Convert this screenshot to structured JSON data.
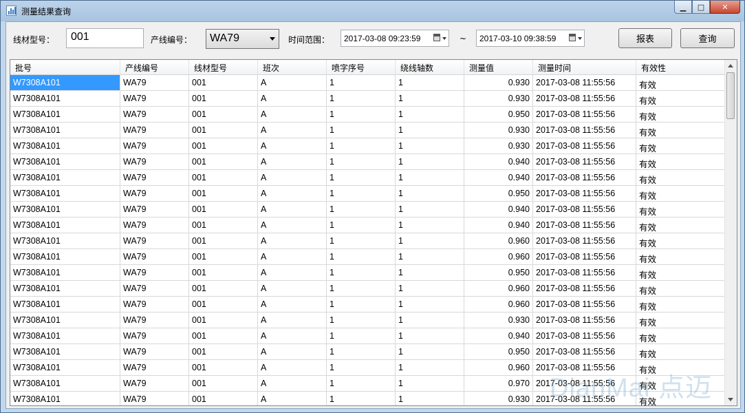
{
  "window": {
    "title": "测量结果查询",
    "buttons": {
      "minimize": "▁",
      "maximize": "□",
      "close": "✕"
    }
  },
  "filters": {
    "wire_type_label": "线材型号：",
    "wire_type_value": "001",
    "line_no_label": "产线编号：",
    "line_no_value": "WA79",
    "time_range_label": "时间范围：",
    "start_time": "2017-03-08 09:23:59",
    "tilde": "~",
    "end_time": "2017-03-10 09:38:59",
    "report_button": "报表",
    "query_button": "查询"
  },
  "table": {
    "columns": [
      "批号",
      "产线编号",
      "线材型号",
      "班次",
      "喷字序号",
      "绕线轴数",
      "测量值",
      "测量时间",
      "有效性"
    ],
    "rows": [
      [
        "W7308A101",
        "WA79",
        "001",
        "A",
        "1",
        "1",
        "0.930",
        "2017-03-08 11:55:56",
        "有效"
      ],
      [
        "W7308A101",
        "WA79",
        "001",
        "A",
        "1",
        "1",
        "0.930",
        "2017-03-08 11:55:56",
        "有效"
      ],
      [
        "W7308A101",
        "WA79",
        "001",
        "A",
        "1",
        "1",
        "0.950",
        "2017-03-08 11:55:56",
        "有效"
      ],
      [
        "W7308A101",
        "WA79",
        "001",
        "A",
        "1",
        "1",
        "0.930",
        "2017-03-08 11:55:56",
        "有效"
      ],
      [
        "W7308A101",
        "WA79",
        "001",
        "A",
        "1",
        "1",
        "0.930",
        "2017-03-08 11:55:56",
        "有效"
      ],
      [
        "W7308A101",
        "WA79",
        "001",
        "A",
        "1",
        "1",
        "0.940",
        "2017-03-08 11:55:56",
        "有效"
      ],
      [
        "W7308A101",
        "WA79",
        "001",
        "A",
        "1",
        "1",
        "0.940",
        "2017-03-08 11:55:56",
        "有效"
      ],
      [
        "W7308A101",
        "WA79",
        "001",
        "A",
        "1",
        "1",
        "0.950",
        "2017-03-08 11:55:56",
        "有效"
      ],
      [
        "W7308A101",
        "WA79",
        "001",
        "A",
        "1",
        "1",
        "0.940",
        "2017-03-08 11:55:56",
        "有效"
      ],
      [
        "W7308A101",
        "WA79",
        "001",
        "A",
        "1",
        "1",
        "0.940",
        "2017-03-08 11:55:56",
        "有效"
      ],
      [
        "W7308A101",
        "WA79",
        "001",
        "A",
        "1",
        "1",
        "0.960",
        "2017-03-08 11:55:56",
        "有效"
      ],
      [
        "W7308A101",
        "WA79",
        "001",
        "A",
        "1",
        "1",
        "0.960",
        "2017-03-08 11:55:56",
        "有效"
      ],
      [
        "W7308A101",
        "WA79",
        "001",
        "A",
        "1",
        "1",
        "0.950",
        "2017-03-08 11:55:56",
        "有效"
      ],
      [
        "W7308A101",
        "WA79",
        "001",
        "A",
        "1",
        "1",
        "0.960",
        "2017-03-08 11:55:56",
        "有效"
      ],
      [
        "W7308A101",
        "WA79",
        "001",
        "A",
        "1",
        "1",
        "0.960",
        "2017-03-08 11:55:56",
        "有效"
      ],
      [
        "W7308A101",
        "WA79",
        "001",
        "A",
        "1",
        "1",
        "0.930",
        "2017-03-08 11:55:56",
        "有效"
      ],
      [
        "W7308A101",
        "WA79",
        "001",
        "A",
        "1",
        "1",
        "0.940",
        "2017-03-08 11:55:56",
        "有效"
      ],
      [
        "W7308A101",
        "WA79",
        "001",
        "A",
        "1",
        "1",
        "0.950",
        "2017-03-08 11:55:56",
        "有效"
      ],
      [
        "W7308A101",
        "WA79",
        "001",
        "A",
        "1",
        "1",
        "0.960",
        "2017-03-08 11:55:56",
        "有效"
      ],
      [
        "W7308A101",
        "WA79",
        "001",
        "A",
        "1",
        "1",
        "0.970",
        "2017-03-08 11:55:56",
        "有效"
      ],
      [
        "W7308A101",
        "WA79",
        "001",
        "A",
        "1",
        "1",
        "0.930",
        "2017-03-08 11:55:56",
        "有效"
      ]
    ]
  },
  "watermark": "DianMai 点迈",
  "colors": {
    "selection": "#3399ff",
    "titlebar": "#bcd3ea"
  }
}
